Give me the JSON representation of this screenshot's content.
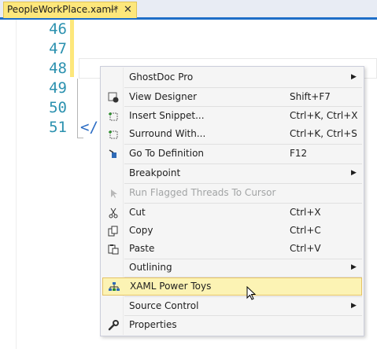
{
  "tab": {
    "title": "PeopleWorkPlace.xaml*",
    "pin": "⊣",
    "close": "✕"
  },
  "editor": {
    "line_numbers": [
      "46",
      "47",
      "48",
      "49",
      "50",
      "51"
    ],
    "code_line": "</"
  },
  "menu": {
    "items": [
      {
        "label": "GhostDoc Pro",
        "shortcut": "",
        "icon": "",
        "submenu": true
      },
      {
        "label": "View Designer",
        "shortcut": "Shift+F7",
        "icon": "designer-icon",
        "submenu": false
      },
      {
        "label": "Insert Snippet...",
        "shortcut": "Ctrl+K, Ctrl+X",
        "icon": "snippet-icon",
        "submenu": false
      },
      {
        "label": "Surround With...",
        "shortcut": "Ctrl+K, Ctrl+S",
        "icon": "surround-icon",
        "submenu": false
      },
      {
        "label": "Go To Definition",
        "shortcut": "F12",
        "icon": "goto-definition-icon",
        "submenu": false
      },
      {
        "label": "Breakpoint",
        "shortcut": "",
        "icon": "",
        "submenu": true
      },
      {
        "label": "Run Flagged Threads To Cursor",
        "shortcut": "",
        "icon": "run-cursor-icon",
        "submenu": false,
        "disabled": true
      },
      {
        "label": "Cut",
        "shortcut": "Ctrl+X",
        "icon": "scissors-icon",
        "submenu": false
      },
      {
        "label": "Copy",
        "shortcut": "Ctrl+C",
        "icon": "copy-icon",
        "submenu": false
      },
      {
        "label": "Paste",
        "shortcut": "Ctrl+V",
        "icon": "paste-icon",
        "submenu": false
      },
      {
        "label": "Outlining",
        "shortcut": "",
        "icon": "",
        "submenu": true
      },
      {
        "label": "XAML Power Toys",
        "shortcut": "",
        "icon": "power-toys-icon",
        "submenu": false,
        "highlighted": true
      },
      {
        "label": "Source Control",
        "shortcut": "",
        "icon": "",
        "submenu": true
      },
      {
        "label": "Properties",
        "shortcut": "",
        "icon": "wrench-icon",
        "submenu": false
      }
    ],
    "submenu_arrow": "▶"
  },
  "colors": {
    "accent": "#1e6ec8",
    "tab_active": "#fde77b",
    "line_numbers": "#2b91af",
    "highlight": "#fcf3b4"
  }
}
